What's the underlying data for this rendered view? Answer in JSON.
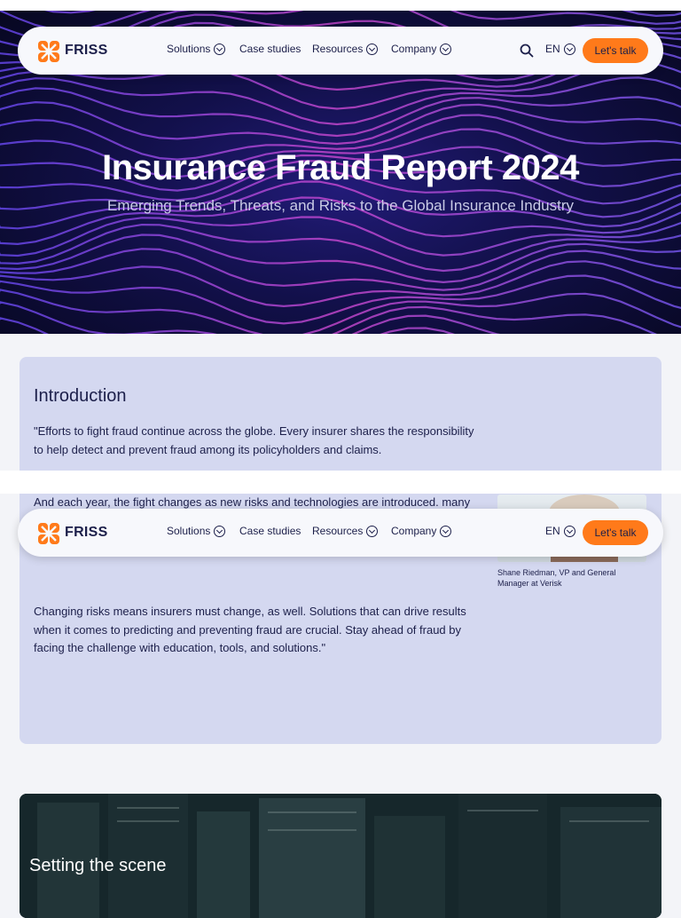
{
  "nav": {
    "brand": "FRISS",
    "items": [
      {
        "label": "Solutions",
        "has_dropdown": true
      },
      {
        "label": "Case studies",
        "has_dropdown": false
      },
      {
        "label": "Resources",
        "has_dropdown": true
      },
      {
        "label": "Company",
        "has_dropdown": true
      }
    ],
    "language": "EN",
    "cta_label": "Let's talk",
    "icons": {
      "search": "search-icon",
      "chevron": "chevron-down-circle-icon",
      "logo": "friss-logo-icon"
    },
    "accent_color": "#ff7a1a"
  },
  "hero": {
    "title": "Insurance Fraud Report 2024",
    "subtitle": "Emerging Trends, Threats, and Risks to the Global Insurance Industry"
  },
  "intro": {
    "heading": "Introduction",
    "paragraph1": "\"Efforts to fight fraud continue across the globe. Every insurer shares the responsibility to help detect and prevent fraud among its policyholders and claims.",
    "paragraph2": "And each year, the fight changes as new risks and technologies are introduced. many traditional investigative measures. But impressions on fraud detection are changing as technology keeps pace and new tools and solutions are introduced.",
    "paragraph3": "Changing risks means insurers must change, as well. Solutions that can drive results when it comes to predicting and preventing fraud are crucial. Stay ahead of fraud by facing the challenge with education, tools, and solutions.\"",
    "caption": "Shane Riedman, VP and General Manager at Verisk"
  },
  "scene": {
    "title": "Setting the scene"
  },
  "colors": {
    "navy": "#1c1f4a",
    "card_bg": "#d4d8f0",
    "page_bg": "#f3f4f8"
  }
}
